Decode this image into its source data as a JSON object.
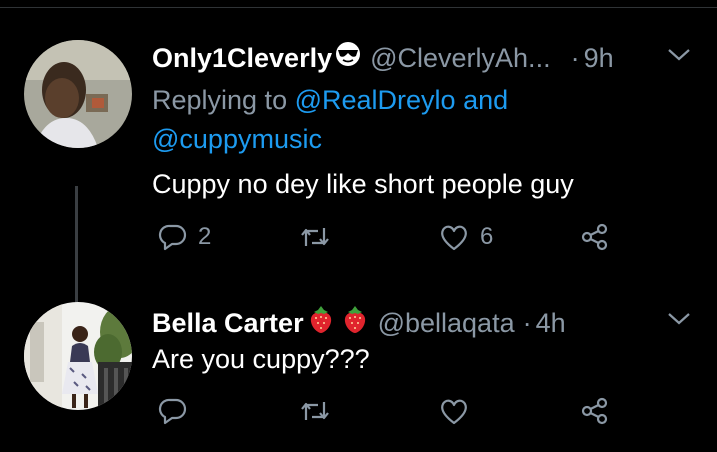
{
  "tweets": [
    {
      "name": "Only1Cleverly",
      "name_emoji": "sunglasses-emoji",
      "handle": "@CleverlyAh...",
      "dot": "·",
      "time": "9h",
      "replying_prefix": "Replying to",
      "replying_to_1": "@RealDreylo",
      "replying_and": "and",
      "replying_to_2": "@cuppymusic",
      "text": "Cuppy no dey like short people guy",
      "reply_count": "2",
      "retweet_count": "",
      "like_count": "6"
    },
    {
      "name": "Bella Carter",
      "name_emoji": "strawberry-emoji",
      "handle": "@bellaqata",
      "dot": "·",
      "time": "4h",
      "text": "Are you cuppy???",
      "reply_count": "",
      "retweet_count": "",
      "like_count": ""
    }
  ],
  "colors": {
    "background": "#000000",
    "primary_text": "#ffffff",
    "secondary_text": "#8b98a5",
    "link": "#1d9bf0",
    "thread_line": "#3a3e42"
  },
  "icons": [
    "reply-icon",
    "retweet-icon",
    "like-icon",
    "share-icon",
    "chevron-down-icon"
  ]
}
